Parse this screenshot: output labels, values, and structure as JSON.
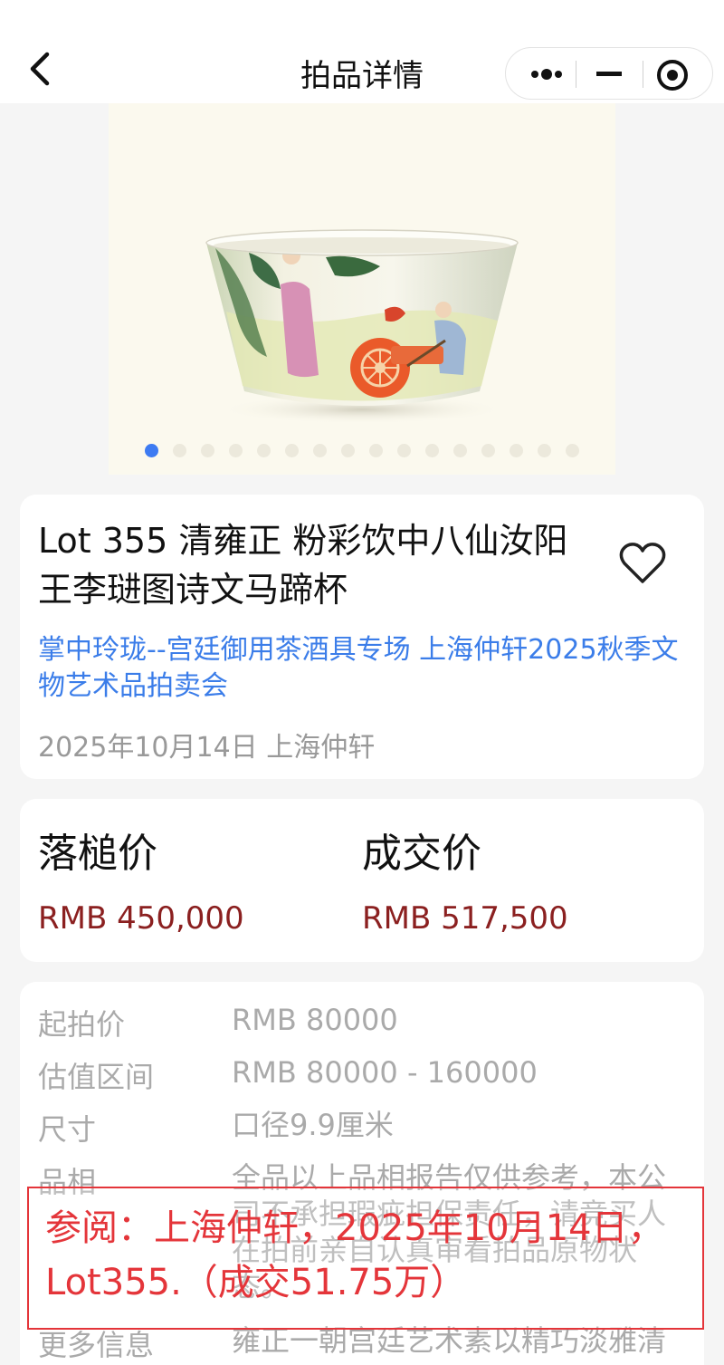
{
  "navbar": {
    "title": "拍品详情",
    "back_icon": "chevron-left-icon",
    "more_icon": "more-dots-icon",
    "minimize_icon": "minimize-icon",
    "close_icon": "target-circle-icon"
  },
  "hero": {
    "image_icon": "porcelain-cup-image",
    "carousel": {
      "total": 16,
      "active_index": 1
    }
  },
  "lot": {
    "title": "Lot 355 清雍正 粉彩饮中八仙汝阳王李琎图诗文马蹄杯",
    "favorite_icon": "heart-outline-icon",
    "sale_name": "掌中玲珑--宫廷御用茶酒具专场 上海仲轩2025秋季文物艺术品拍卖会",
    "date_house": "2025年10月14日 上海仲轩"
  },
  "prices": {
    "hammer_label": "落槌价",
    "hammer_value": "RMB 450,000",
    "final_label": "成交价",
    "final_value": "RMB 517,500"
  },
  "details": [
    {
      "key": "起拍价",
      "value": "RMB 80000"
    },
    {
      "key": "估值区间",
      "value": "RMB 80000 - 160000"
    },
    {
      "key": "尺寸",
      "value": "口径9.9厘米"
    },
    {
      "key": "品相",
      "value": "全品以上品相报告仅供参考，本公司不承担瑕疵担保责任，请竞买人在拍前亲自认真审看拍品原物状态。"
    },
    {
      "key": "更多信息",
      "value": "雍正一朝宫廷艺术素以精巧淡雅清"
    }
  ],
  "watermark": {
    "text": "参阅：上海仲轩，2025年10月14日，Lot355.（成交51.75万）"
  },
  "colors": {
    "accent_blue": "#3b7de9",
    "price_red": "#8b2020",
    "watermark_red": "#e4353a",
    "dot_active": "#3d7bf2"
  }
}
